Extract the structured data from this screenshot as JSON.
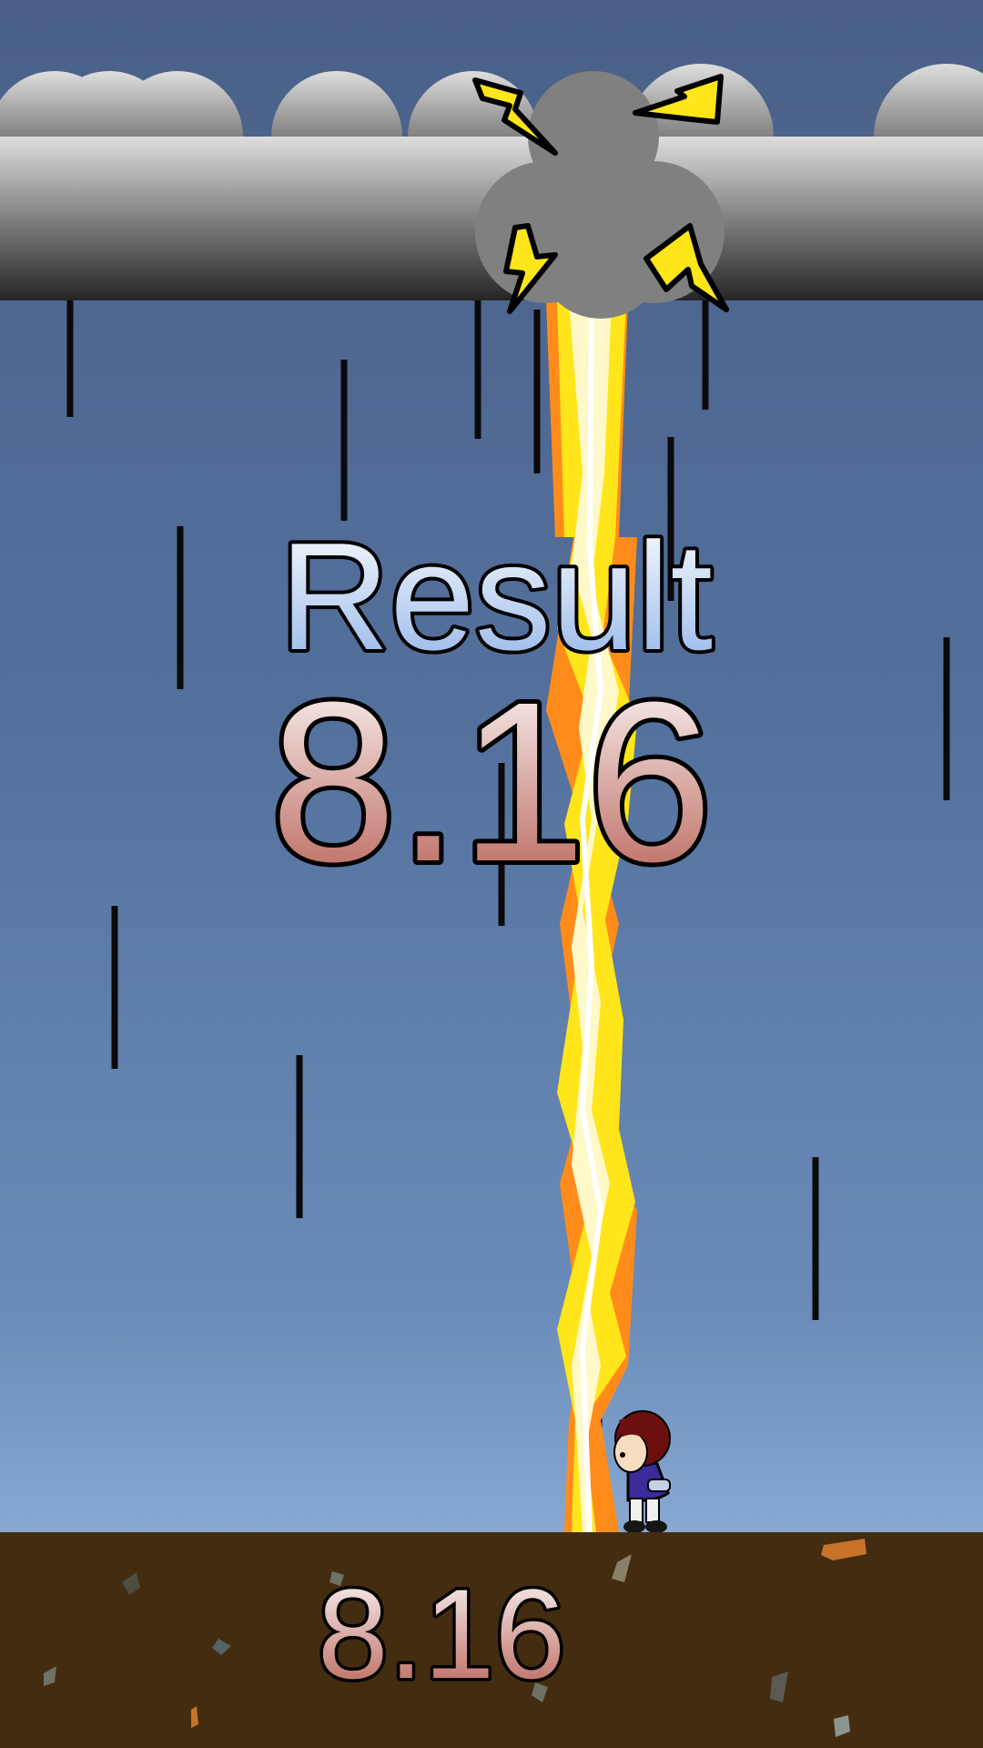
{
  "result_title": "Result",
  "result_value": "8.16",
  "ground_score": "8.16",
  "colors": {
    "sky_top": "#4a6088",
    "sky_bottom": "#a4c3e6",
    "cloud_light": "#dcdcdc",
    "cloud_dark": "#2a2a2a",
    "bolt_yellow": "#ffe51a",
    "bolt_orange": "#ff8c1a",
    "ground": "#432c10",
    "title_top": "#ffffff",
    "title_bottom": "#8fb2e8",
    "number_top": "#ffffff",
    "number_bottom": "#b55a4e"
  },
  "icons": {
    "cloud": "storm-cloud-icon",
    "spark": "lightning-spark-icon",
    "character": "player-character"
  }
}
